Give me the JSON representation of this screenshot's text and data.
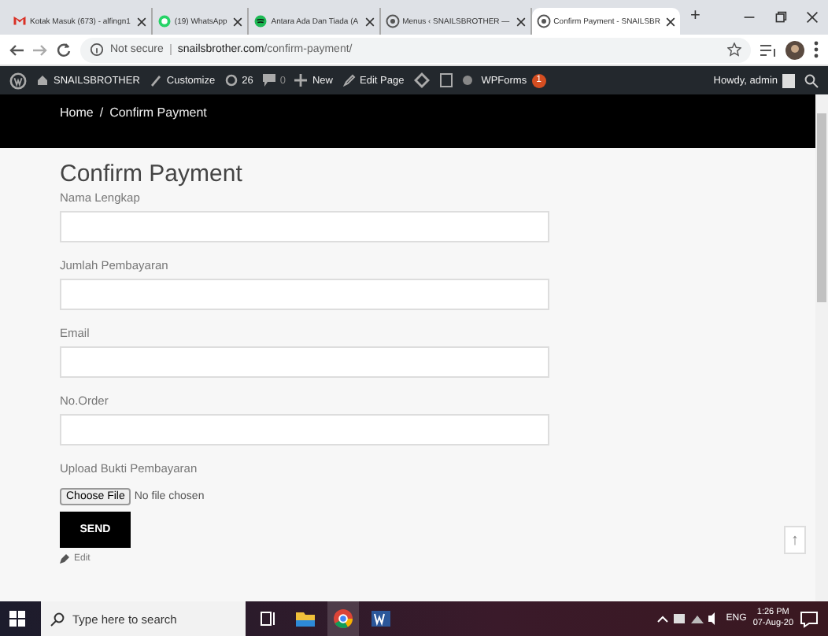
{
  "browser": {
    "tabs": [
      {
        "title": "Kotak Masuk (673) - alfingn1",
        "kind": "mail",
        "selected": false
      },
      {
        "title": "(19) WhatsApp",
        "kind": "whatsapp",
        "selected": false
      },
      {
        "title": "Antara Ada Dan Tiada (A",
        "kind": "music",
        "selected": false
      },
      {
        "title": "Menus ‹ SNAILSBROTHER —",
        "kind": "site",
        "selected": false
      },
      {
        "title": "Confirm Payment - SNAILSBR",
        "kind": "site",
        "selected": true
      }
    ],
    "new_tab": "+",
    "security": "Not secure",
    "url_host": "snailsbrother.com",
    "url_path": "/confirm-payment/"
  },
  "admin_bar": {
    "site": "SNAILSBROTHER",
    "customize": "Customize",
    "updates": "26",
    "comments": "0",
    "new": "New",
    "edit_page": "Edit Page",
    "wpforms": "WPForms",
    "wpforms_count": "1",
    "greeting": "Howdy, admin"
  },
  "breadcrumb": [
    "Home",
    "/",
    "Confirm Payment"
  ],
  "page_title": "Confirm Payment",
  "fields": [
    {
      "label": "Nama Lengkap"
    },
    {
      "label": "Jumlah Pembayaran"
    },
    {
      "label": "Email"
    },
    {
      "label": "No.Order"
    }
  ],
  "upload": {
    "label": "Upload Bukti Pembayaran",
    "button": "Choose File",
    "status": "No file chosen"
  },
  "submit": "SEND",
  "scroll_top": "↑",
  "edit_link": "Edit",
  "taskbar": {
    "search_placeholder": "Type here to search",
    "lang": "ENG",
    "time": "1:26 PM",
    "date": "07-Aug-20"
  }
}
